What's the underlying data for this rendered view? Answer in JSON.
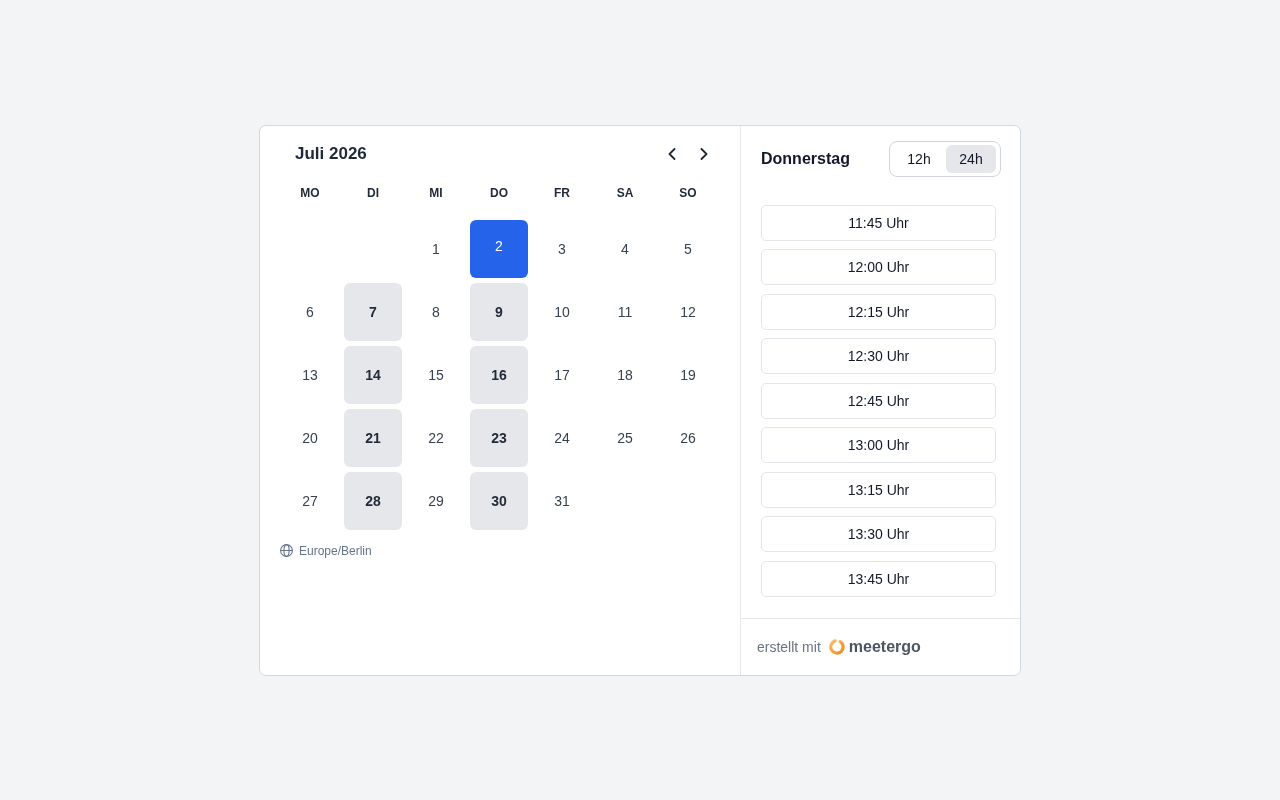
{
  "calendar": {
    "month_title": "Juli 2026",
    "weekdays": [
      "MO",
      "DI",
      "MI",
      "DO",
      "FR",
      "SA",
      "SO"
    ],
    "weeks": [
      [
        {
          "day": "1",
          "available": false,
          "selected": false
        },
        {
          "day": "2",
          "available": true,
          "selected": true
        },
        {
          "day": "3",
          "available": false,
          "selected": false
        },
        {
          "day": "4",
          "available": false,
          "selected": false
        },
        {
          "day": "5",
          "available": false,
          "selected": false
        }
      ],
      [
        {
          "day": "6",
          "available": false,
          "selected": false
        },
        {
          "day": "7",
          "available": true,
          "selected": false
        },
        {
          "day": "8",
          "available": false,
          "selected": false
        },
        {
          "day": "9",
          "available": true,
          "selected": false
        },
        {
          "day": "10",
          "available": false,
          "selected": false
        },
        {
          "day": "11",
          "available": false,
          "selected": false
        },
        {
          "day": "12",
          "available": false,
          "selected": false
        }
      ],
      [
        {
          "day": "13",
          "available": false,
          "selected": false
        },
        {
          "day": "14",
          "available": true,
          "selected": false
        },
        {
          "day": "15",
          "available": false,
          "selected": false
        },
        {
          "day": "16",
          "available": true,
          "selected": false
        },
        {
          "day": "17",
          "available": false,
          "selected": false
        },
        {
          "day": "18",
          "available": false,
          "selected": false
        },
        {
          "day": "19",
          "available": false,
          "selected": false
        }
      ],
      [
        {
          "day": "20",
          "available": false,
          "selected": false
        },
        {
          "day": "21",
          "available": true,
          "selected": false
        },
        {
          "day": "22",
          "available": false,
          "selected": false
        },
        {
          "day": "23",
          "available": true,
          "selected": false
        },
        {
          "day": "24",
          "available": false,
          "selected": false
        },
        {
          "day": "25",
          "available": false,
          "selected": false
        },
        {
          "day": "26",
          "available": false,
          "selected": false
        }
      ],
      [
        {
          "day": "27",
          "available": false,
          "selected": false
        },
        {
          "day": "28",
          "available": true,
          "selected": false
        },
        {
          "day": "29",
          "available": false,
          "selected": false
        },
        {
          "day": "30",
          "available": true,
          "selected": false
        },
        {
          "day": "31",
          "available": false,
          "selected": false
        }
      ]
    ],
    "timezone": "Europe/Berlin"
  },
  "times": {
    "day_title": "Donnerstag",
    "formats": [
      {
        "label": "12h",
        "selected": false
      },
      {
        "label": "24h",
        "selected": true
      }
    ],
    "slots": [
      "11:45 Uhr",
      "12:00 Uhr",
      "12:15 Uhr",
      "12:30 Uhr",
      "12:45 Uhr",
      "13:00 Uhr",
      "13:15 Uhr",
      "13:30 Uhr",
      "13:45 Uhr"
    ]
  },
  "footer": {
    "prefix": "erstellt mit",
    "brand": "meetergo"
  }
}
